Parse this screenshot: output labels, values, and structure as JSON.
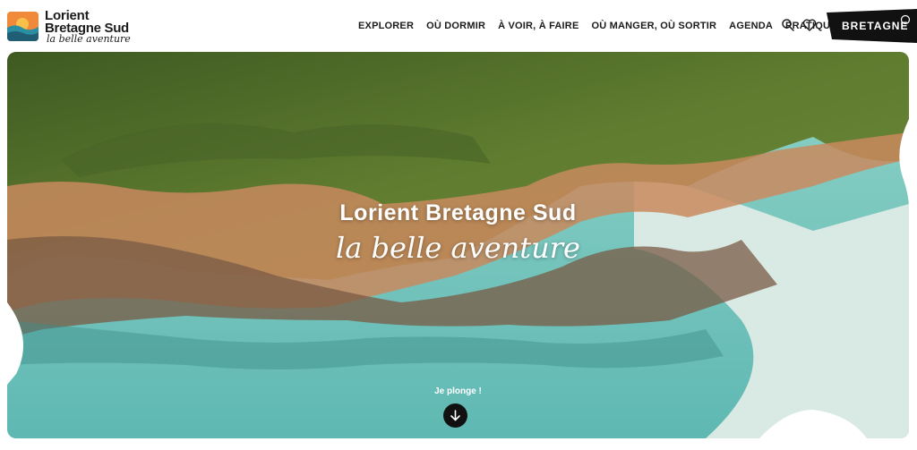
{
  "logo": {
    "line1": "Lorient",
    "line2": "Bretagne Sud",
    "tagline": "la belle aventure"
  },
  "nav": {
    "items": [
      "EXPLORER",
      "OÙ DORMIR",
      "À VOIR, À FAIRE",
      "OÙ MANGER, OÙ SORTIR",
      "AGENDA",
      "PRATIQUE"
    ]
  },
  "icons": {
    "search": "search-icon",
    "favorites": "heart-icon",
    "scroll": "arrow-down-icon"
  },
  "brand_badge": {
    "label": "BRETAGNE"
  },
  "hero": {
    "title": "Lorient Bretagne Sud",
    "subtitle": "la belle aventure",
    "cta_label": "Je plonge !"
  },
  "colors": {
    "text": "#1b1b1b",
    "badge": "#111111",
    "sea": "#6cc3bd",
    "forest": "#4f6b2a",
    "rock": "#c98a5e"
  }
}
